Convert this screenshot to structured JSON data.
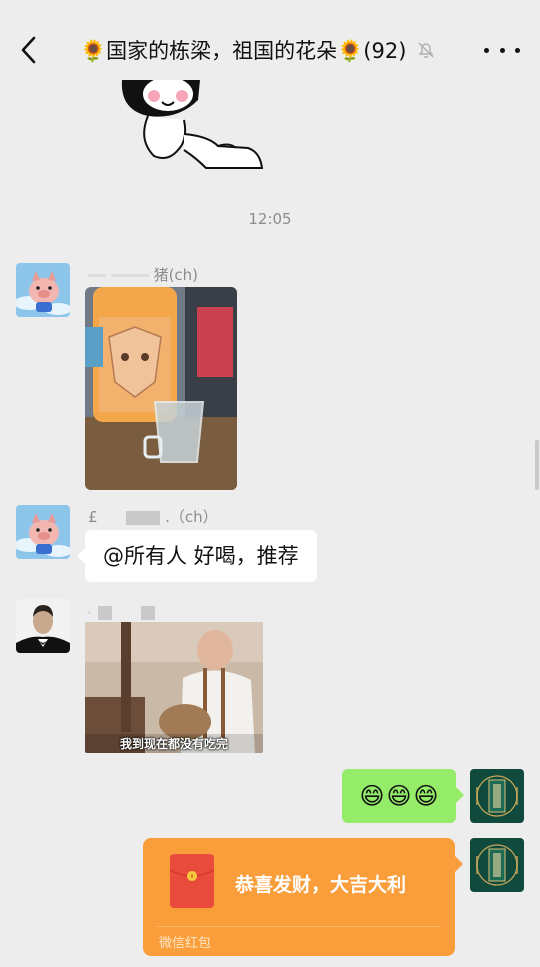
{
  "header": {
    "title": "🌻国家的栋梁，祖国的花朵🌻(92)"
  },
  "messages": {
    "time": "12:05",
    "msg1": {
      "sender": "(ch)",
      "sender_prefix": "猪"
    },
    "msg2": {
      "sender": ".（ch）",
      "sender_prefix": "£",
      "text": "@所有人  好喝，推荐"
    },
    "msg3": {
      "image_caption": "我到现在都没有吃完"
    },
    "msg4": {
      "emojis": [
        "😄",
        "😄",
        "😄"
      ]
    },
    "msg5": {
      "text": "恭喜发财，大吉大利",
      "label": "微信红包"
    }
  },
  "colors": {
    "background": "#ededed",
    "bubble_self": "#95ec69",
    "bubble_other": "#ffffff",
    "red_packet": "#fa9d3b"
  },
  "icons": {
    "back": "chevron-left-icon",
    "mute": "bell-off-icon",
    "more": "more-horizontal-icon"
  }
}
